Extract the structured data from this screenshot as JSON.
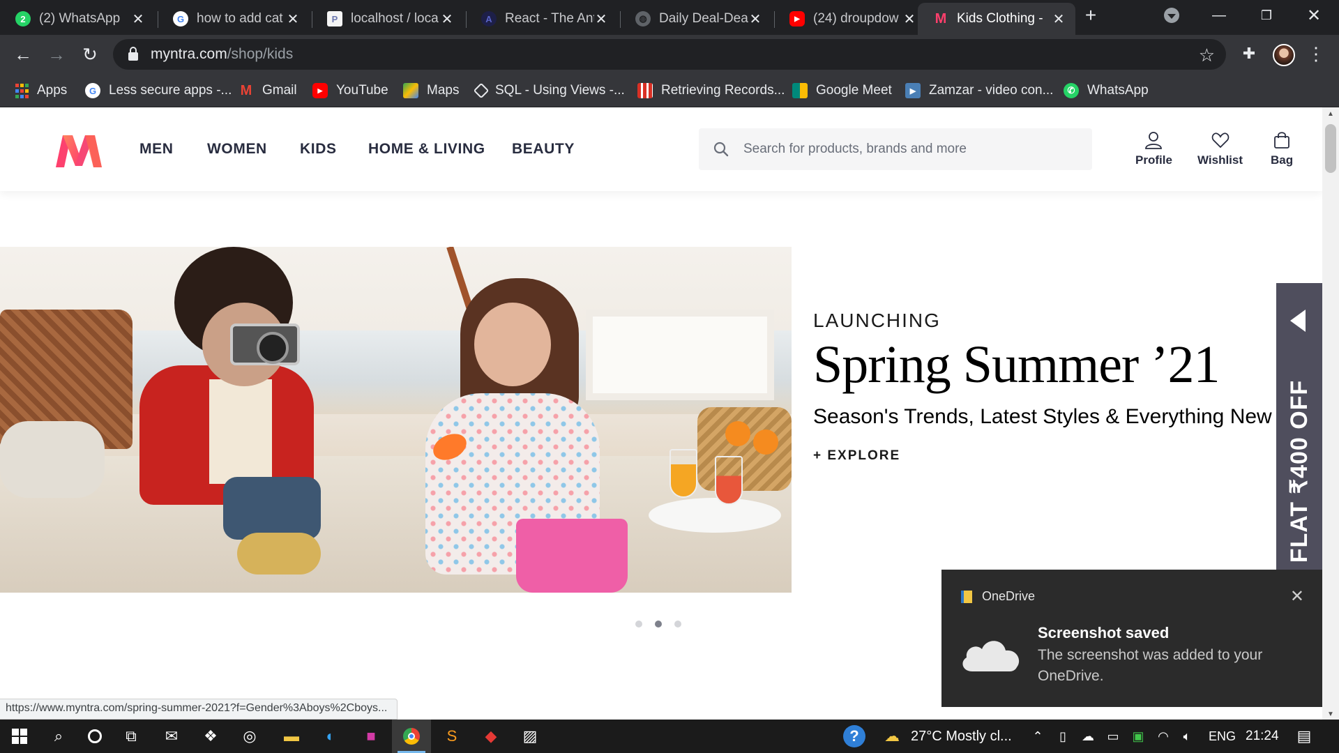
{
  "browser": {
    "tabs": [
      {
        "title": "(2) WhatsApp",
        "favicon": "whatsapp-icon",
        "color": "#25d366",
        "glyph": "2"
      },
      {
        "title": "how to add cat",
        "favicon": "google-icon",
        "color": "#ffffff",
        "glyph": "G"
      },
      {
        "title": "localhost / loca",
        "favicon": "phpmyadmin-icon",
        "color": "#f5f5f5",
        "glyph": "P"
      },
      {
        "title": "React - The Ant",
        "favicon": "antd-icon",
        "color": "#1d1f48",
        "glyph": "A"
      },
      {
        "title": "Daily Deal-Dea",
        "favicon": "globe-icon",
        "color": "#5f6368",
        "glyph": ""
      },
      {
        "title": "(24) droupdow",
        "favicon": "youtube-icon",
        "color": "#ff0000",
        "glyph": "▶"
      },
      {
        "title": "Kids Clothing -",
        "favicon": "myntra-icon",
        "color": "#ff3f6c",
        "glyph": "M",
        "active": true
      }
    ],
    "url_host": "myntra.com",
    "url_path": "/shop/kids",
    "bookmarks": [
      {
        "label": "Apps",
        "icon": "apps-grid-icon",
        "color": "#4285f4"
      },
      {
        "label": "Less secure apps -...",
        "icon": "google-icon",
        "color": "#ffffff"
      },
      {
        "label": "Gmail",
        "icon": "gmail-icon",
        "color": "#ea4335"
      },
      {
        "label": "YouTube",
        "icon": "youtube-icon",
        "color": "#ff0000"
      },
      {
        "label": "Maps",
        "icon": "maps-icon",
        "color": "#34a853"
      },
      {
        "label": "SQL - Using Views -...",
        "icon": "sql-icon",
        "color": "#e8eaed"
      },
      {
        "label": "Retrieving Records...",
        "icon": "records-icon",
        "color": "#d93025"
      },
      {
        "label": "Google Meet",
        "icon": "google-meet-icon",
        "color": "#00897b"
      },
      {
        "label": "Zamzar - video con...",
        "icon": "zamzar-icon",
        "color": "#4a7fb5"
      },
      {
        "label": "WhatsApp",
        "icon": "whatsapp-icon",
        "color": "#25d366"
      }
    ],
    "status_url": "https://www.myntra.com/spring-summer-2021?f=Gender%3Aboys%2Cboys..."
  },
  "site": {
    "nav": [
      "MEN",
      "WOMEN",
      "KIDS",
      "HOME & LIVING",
      "BEAUTY"
    ],
    "search_placeholder": "Search for products, brands and more",
    "actions": {
      "profile": "Profile",
      "wishlist": "Wishlist",
      "bag": "Bag"
    },
    "brand_colors": {
      "pink": "#ff3f6c",
      "orange": "#ff905a",
      "text": "#282c3f"
    }
  },
  "hero": {
    "kicker": "LAUNCHING",
    "title": "Spring Summer ’21",
    "subtitle": "Season's Trends, Latest Styles & Everything New",
    "cta": "+ EXPLORE",
    "offer": "FLAT ₹400 OFF",
    "slides": 3,
    "active_slide": 2
  },
  "toast": {
    "app": "OneDrive",
    "title": "Screenshot saved",
    "body": "The screenshot was added to your OneDrive."
  },
  "taskbar": {
    "weather": "27°C  Mostly cl...",
    "language": "ENG",
    "time": "21:24"
  }
}
